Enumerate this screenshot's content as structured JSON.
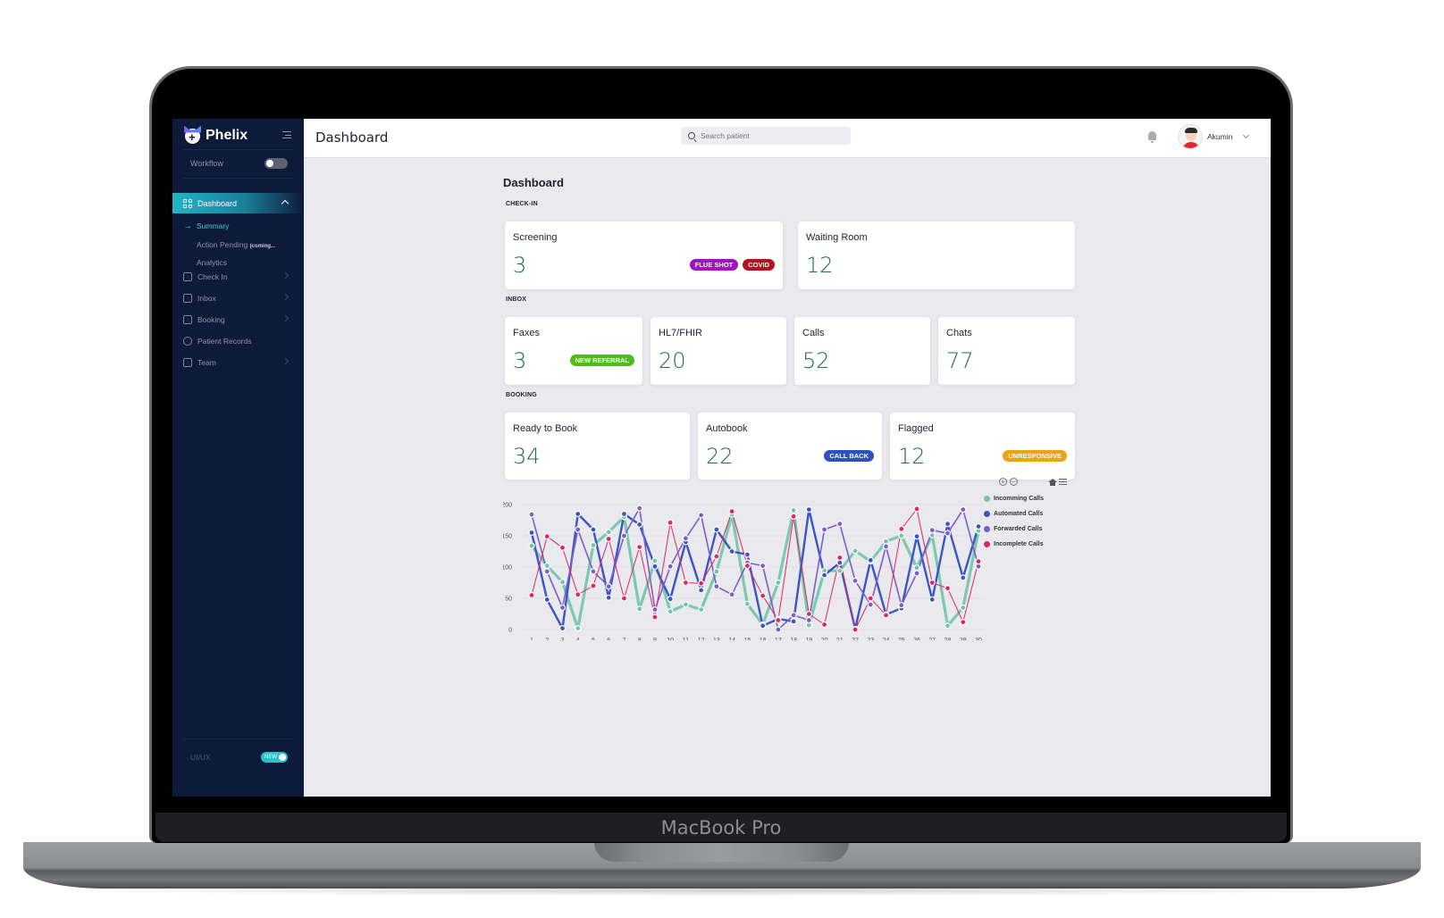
{
  "device_label": "MacBook Pro",
  "sidebar": {
    "brand": "Phelix",
    "workflow_label": "Workflow",
    "active_item": "Dashboard",
    "sub_items": [
      {
        "label": "Summary",
        "active": true
      },
      {
        "label": "Action Pending",
        "tag": "(coming..."
      },
      {
        "label": "Analytics"
      }
    ],
    "items": [
      {
        "label": "Check In",
        "icon": "calendar-check-icon",
        "has_chevron": true
      },
      {
        "label": "Inbox",
        "icon": "inbox-icon",
        "has_chevron": true
      },
      {
        "label": "Booking",
        "icon": "calendar-icon",
        "has_chevron": true
      },
      {
        "label": "Patient Records",
        "icon": "search-icon",
        "has_chevron": false
      },
      {
        "label": "Team",
        "icon": "team-icon",
        "has_chevron": true
      }
    ],
    "footer_label": "UI/UX",
    "footer_toggle_label": "NEW"
  },
  "header": {
    "title": "Dashboard",
    "search_placeholder": "Search patient",
    "user_name": "Akumin"
  },
  "content": {
    "title": "Dashboard",
    "sections": {
      "checkin": {
        "label": "CHECK-IN",
        "cards": [
          {
            "label": "Screening",
            "value": "3",
            "badges": [
              {
                "text": "FLUE SHOT",
                "color": "#a012c4"
              },
              {
                "text": "COVID",
                "color": "#b8101e"
              }
            ]
          },
          {
            "label": "Waiting Room",
            "value": "12",
            "badges": []
          }
        ]
      },
      "inbox": {
        "label": "INBOX",
        "cards": [
          {
            "label": "Faxes",
            "value": "3",
            "badges": [
              {
                "text": "NEW REFERRAL",
                "color": "#4cbe1a"
              }
            ]
          },
          {
            "label": "HL7/FHIR",
            "value": "20",
            "badges": []
          },
          {
            "label": "Calls",
            "value": "52",
            "badges": []
          },
          {
            "label": "Chats",
            "value": "77",
            "badges": []
          }
        ]
      },
      "booking": {
        "label": "BOOKING",
        "cards": [
          {
            "label": "Ready to Book",
            "value": "34",
            "badges": []
          },
          {
            "label": "Autobook",
            "value": "22",
            "badges": [
              {
                "text": "CALL BACK",
                "color": "#2f4fc7"
              }
            ]
          },
          {
            "label": "Flagged",
            "value": "12",
            "badges": [
              {
                "text": "UNRESPONSIVE",
                "color": "#f0a20f"
              }
            ]
          }
        ]
      }
    }
  },
  "chart_data": {
    "type": "line",
    "title": "",
    "xlabel": "",
    "ylabel": "",
    "x": [
      1,
      2,
      3,
      4,
      5,
      6,
      7,
      8,
      9,
      10,
      11,
      12,
      13,
      14,
      15,
      16,
      17,
      18,
      19,
      20,
      21,
      22,
      23,
      24,
      25,
      26,
      27,
      28,
      29,
      30
    ],
    "ylim": [
      0,
      200
    ],
    "yticks": [
      0,
      50,
      100,
      150,
      200
    ],
    "grid": true,
    "legend_position": "right",
    "series": [
      {
        "name": "Incomming Calls",
        "color": "#6fc7a6",
        "values": [
          134,
          102,
          76,
          2,
          135,
          156,
          180,
          33,
          110,
          29,
          40,
          32,
          93,
          184,
          41,
          8,
          75,
          191,
          7,
          94,
          94,
          126,
          109,
          141,
          150,
          99,
          151,
          6,
          35,
          158
        ]
      },
      {
        "name": "Automated Calls",
        "color": "#3a56c4",
        "values": [
          155,
          48,
          2,
          185,
          160,
          51,
          185,
          168,
          101,
          49,
          140,
          63,
          160,
          125,
          120,
          6,
          17,
          13,
          192,
          87,
          107,
          1,
          111,
          24,
          34,
          149,
          48,
          169,
          83,
          165
        ]
      },
      {
        "name": "Forwarded Calls",
        "color": "#7c5ec9",
        "values": [
          184,
          93,
          35,
          160,
          93,
          69,
          150,
          194,
          32,
          101,
          146,
          183,
          69,
          56,
          107,
          102,
          0,
          23,
          15,
          160,
          169,
          78,
          40,
          133,
          39,
          90,
          159,
          154,
          192,
          101
        ]
      },
      {
        "name": "Incomplete Calls",
        "color": "#de2764",
        "values": [
          55,
          149,
          131,
          56,
          70,
          145,
          50,
          132,
          20,
          171,
          75,
          74,
          117,
          189,
          102,
          54,
          15,
          181,
          25,
          8,
          115,
          0,
          50,
          23,
          161,
          193,
          75,
          66,
          12,
          109
        ]
      }
    ]
  }
}
